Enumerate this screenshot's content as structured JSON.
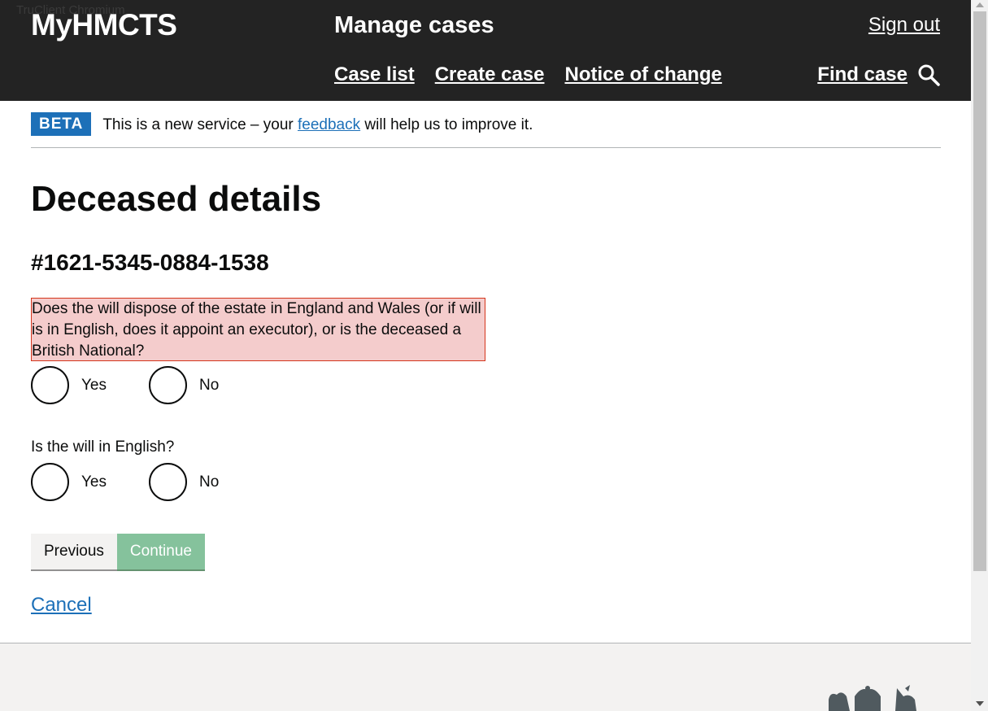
{
  "watermark": "TruClient Chromium",
  "header": {
    "brand": "MyHMCTS",
    "service_name": "Manage cases",
    "sign_out": "Sign out",
    "nav": [
      "Case list",
      "Create case",
      "Notice of change"
    ],
    "find_case": "Find case"
  },
  "beta_banner": {
    "tag": "BETA",
    "text_before": "This is a new service – your ",
    "link": "feedback",
    "text_after": " will help us to improve it."
  },
  "page": {
    "title": "Deceased details",
    "case_reference": "#1621-5345-0884-1538"
  },
  "questions": [
    {
      "label": "Does the will dispose of the estate in England and Wales (or if will is in English, does it appoint an executor), or is the deceased a British National?",
      "has_error": true,
      "options": [
        "Yes",
        "No"
      ]
    },
    {
      "label": "Is the will in English?",
      "has_error": false,
      "options": [
        "Yes",
        "No"
      ]
    }
  ],
  "buttons": {
    "previous": "Previous",
    "continue": "Continue"
  },
  "cancel_link": "Cancel",
  "colors": {
    "header_bg": "#232323",
    "link": "#1d70b8",
    "beta_tag": "#1d70b8",
    "error_bg": "#f4cccc",
    "error_border": "#d4351c",
    "continue_bg": "#85c29c"
  }
}
